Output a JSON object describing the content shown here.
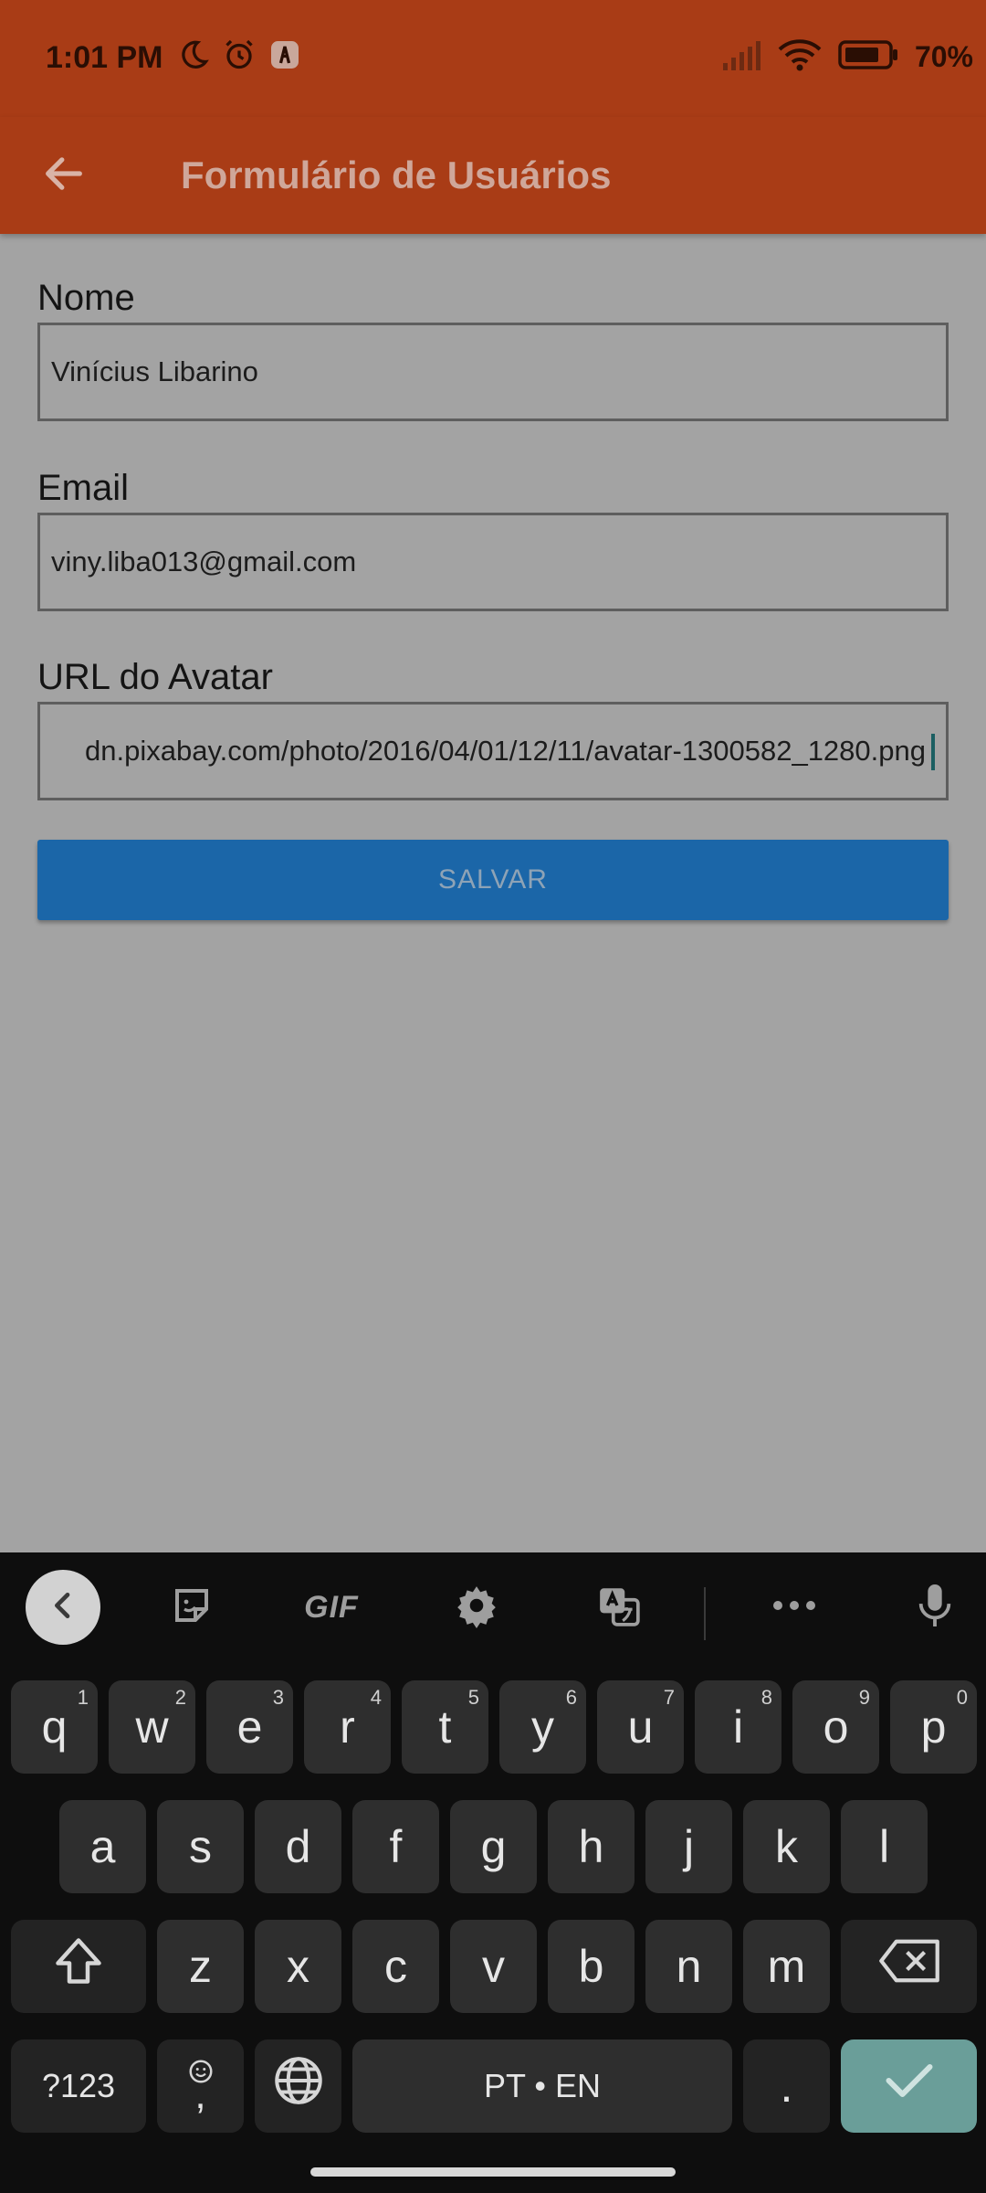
{
  "status_bar": {
    "time": "1:01 PM",
    "battery": "70%",
    "icons": [
      "moon-icon",
      "alarm-icon",
      "app-notification-icon",
      "signal-icon",
      "wifi-icon",
      "battery-icon"
    ]
  },
  "app_bar": {
    "title": "Formulário de Usuários",
    "back_icon": "arrow-left-icon",
    "color": "#a93c16"
  },
  "form": {
    "fields": [
      {
        "label": "Nome",
        "value": "Vinícius Libarino"
      },
      {
        "label": "Email",
        "value": "viny.liba013@gmail.com"
      },
      {
        "label": "URL do Avatar",
        "value": "dn.pixabay.com/photo/2016/04/01/12/11/avatar-1300582_1280.png"
      }
    ],
    "save_label": "SALVAR",
    "save_color": "#1b66a8"
  },
  "keyboard": {
    "toolbar": [
      "collapse-icon",
      "sticker-icon",
      "GIF",
      "settings-icon",
      "translate-icon",
      "more-icon",
      "mic-icon"
    ],
    "gif_label": "GIF",
    "row1": [
      {
        "k": "q",
        "h": "1"
      },
      {
        "k": "w",
        "h": "2"
      },
      {
        "k": "e",
        "h": "3"
      },
      {
        "k": "r",
        "h": "4"
      },
      {
        "k": "t",
        "h": "5"
      },
      {
        "k": "y",
        "h": "6"
      },
      {
        "k": "u",
        "h": "7"
      },
      {
        "k": "i",
        "h": "8"
      },
      {
        "k": "o",
        "h": "9"
      },
      {
        "k": "p",
        "h": "0"
      }
    ],
    "row2": [
      "a",
      "s",
      "d",
      "f",
      "g",
      "h",
      "j",
      "k",
      "l"
    ],
    "row3": [
      "z",
      "x",
      "c",
      "v",
      "b",
      "n",
      "m"
    ],
    "symbols_label": "?123",
    "comma_label": ",",
    "space_label": "PT • EN",
    "period_label": ".",
    "enter_color": "#6a9e99"
  }
}
